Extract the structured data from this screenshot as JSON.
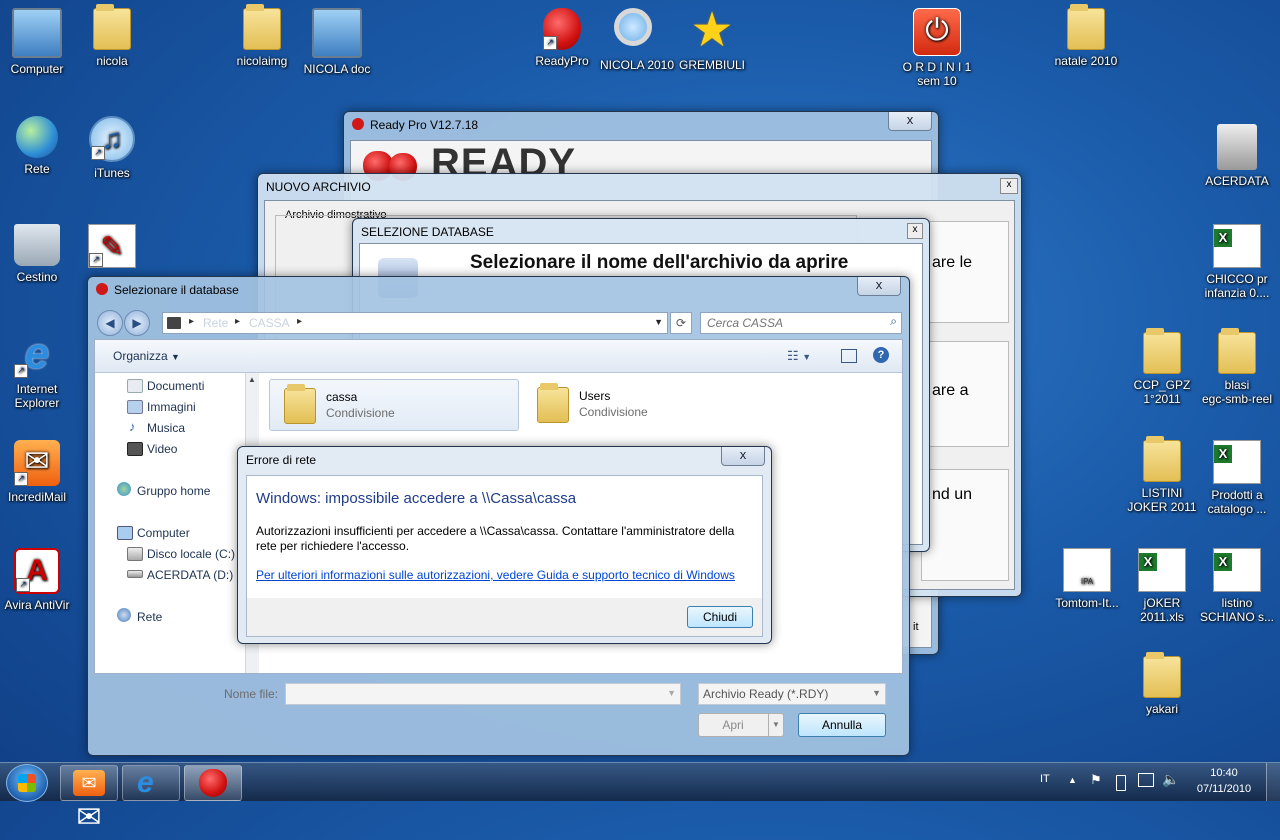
{
  "desktop": {
    "icons": [
      {
        "label": "Computer",
        "type": "computer"
      },
      {
        "label": "nicola",
        "type": "folder"
      },
      {
        "label": "nicolaimg",
        "type": "folder"
      },
      {
        "label": "NICOLA doc",
        "type": "computer"
      },
      {
        "label": "ReadyPro",
        "type": "strawberry"
      },
      {
        "label": "NICOLA 2010",
        "type": "magnifier"
      },
      {
        "label": "GREMBIULI",
        "type": "star"
      },
      {
        "label": "O R D I N I 1",
        "label2": "sem 10",
        "type": "power"
      },
      {
        "label": "natale 2010",
        "type": "folder"
      },
      {
        "label": "Rete",
        "type": "globe"
      },
      {
        "label": "iTunes",
        "type": "itunes"
      },
      {
        "label": "ACERDATA",
        "type": "drive"
      },
      {
        "label": "Cestino",
        "type": "trash"
      },
      {
        "label": "",
        "type": "pdf"
      },
      {
        "label": "CHICCO pr",
        "label2": "infanzia 0....",
        "type": "excel"
      },
      {
        "label": "Internet",
        "label2": "Explorer",
        "type": "ie"
      },
      {
        "label": "CCP_GPZ",
        "label2": "1°2011",
        "type": "folder"
      },
      {
        "label": "blasi",
        "label2": "egc-smb-reel",
        "type": "folder"
      },
      {
        "label": "IncrediMail",
        "type": "mail"
      },
      {
        "label": "LISTINI",
        "label2": "JOKER 2011",
        "type": "folder"
      },
      {
        "label": "Prodotti a",
        "label2": "catalogo ...",
        "type": "excel"
      },
      {
        "label": "Avira AntiVir",
        "type": "avira"
      },
      {
        "label": "Tomtom-It...",
        "type": "ipa"
      },
      {
        "label": "jOKER",
        "label2": "2011.xls",
        "type": "excel"
      },
      {
        "label": "listino",
        "label2": "SCHIANO s...",
        "type": "excel"
      },
      {
        "label": "yakari",
        "type": "folder"
      }
    ]
  },
  "ready_window": {
    "title": "Ready Pro V12.7.18",
    "logo_text": "READY",
    "close": "x"
  },
  "nuovo_archivio": {
    "title": "NUOVO ARCHIVIO",
    "group_label": "Archivio dimostrativo",
    "side_text_1": "are le",
    "side_text_2": "are a",
    "side_text_3": "nd un",
    "close": "x",
    "fragment": "it"
  },
  "selezione_db": {
    "title": "SELEZIONE DATABASE",
    "heading": "Selezionare il nome dell'archivio da aprire",
    "close": "x"
  },
  "file_dialog": {
    "title": "Selezionare il database",
    "close": "x",
    "search_placeholder": "Cerca CASSA",
    "organize": "Organizza",
    "address_parts": [
      "Rete",
      "CASSA"
    ],
    "nav": {
      "documents": "Documenti",
      "images": "Immagini",
      "music": "Musica",
      "video": "Video",
      "homegroup": "Gruppo home",
      "computer": "Computer",
      "local_disk": "Disco locale (C:)",
      "acerdata": "ACERDATA (D:)",
      "network": "Rete"
    },
    "items": [
      {
        "name": "cassa",
        "sub": "Condivisione"
      },
      {
        "name": "Users",
        "sub": "Condivisione"
      }
    ],
    "filename_label": "Nome file:",
    "filename_value": "",
    "filter": "Archivio Ready (*.RDY)",
    "open_btn": "Apri",
    "cancel_btn": "Annulla"
  },
  "error_dialog": {
    "title": "Errore di rete",
    "close": "x",
    "heading": "Windows: impossibile accedere a \\\\Cassa\\cassa",
    "body": "Autorizzazioni insufficienti per accedere a \\\\Cassa\\cassa. Contattare l'amministratore della rete per richiedere l'accesso.",
    "link": "Per ulteriori informazioni sulle autorizzazioni, vedere Guida e supporto tecnico di Windows",
    "button": "Chiudi"
  },
  "taskbar": {
    "language": "IT",
    "time": "10:40",
    "date": "07/11/2010"
  },
  "colors": {
    "heading_blue": "#1f3c88",
    "link_blue": "#0046d5"
  }
}
